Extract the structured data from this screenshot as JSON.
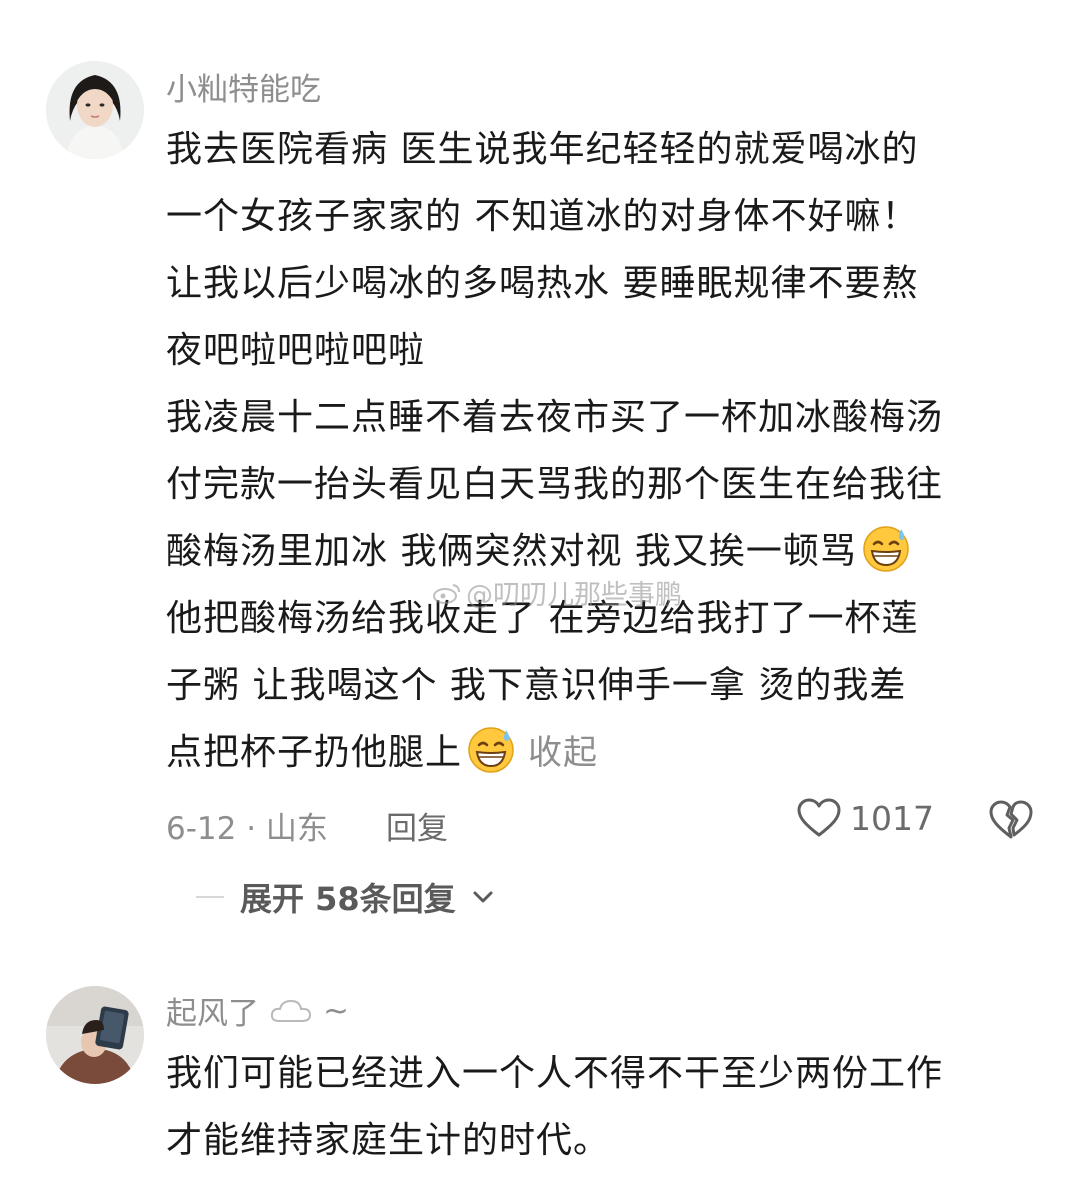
{
  "comments": [
    {
      "username": "小籼特能吃",
      "lines": [
        "我去医院看病  医生说我年纪轻轻的就爱喝冰的",
        "一个女孩子家家的 不知道冰的对身体不好嘛！",
        "让我以后少喝冰的多喝热水  要睡眠规律不要熬",
        "夜吧啦吧啦吧啦",
        "我凌晨十二点睡不着去夜市买了一杯加冰酸梅汤",
        "付完款一抬头看见白天骂我的那个医生在给我往",
        "酸梅汤里加冰  我俩突然对视  我又挨一顿骂",
        "他把酸梅汤给我收走了  在旁边给我打了一杯莲",
        "子粥  让我喝这个  我下意识伸手一拿  烫的我差",
        "点把杯子扔他腿上"
      ],
      "emoji_1": "grinning-sweat-emoji",
      "emoji_2": "grinning-sweat-emoji",
      "collapse_label": "收起",
      "meta": "6-12 · 山东",
      "reply_label": "回复",
      "like_count": "1017",
      "expand_label": "展开 58条回复"
    },
    {
      "username": "起风了",
      "username_suffix": "~",
      "lines": [
        "我们可能已经进入一个人不得不干至少两份工作",
        "才能维持家庭生计的时代。"
      ]
    }
  ],
  "watermark": "@叨叨儿那些事鹏",
  "colors": {
    "secondary_text": "#8e8e8e",
    "primary_text": "#1a1a1a",
    "emoji_face": "#ffc83d"
  }
}
